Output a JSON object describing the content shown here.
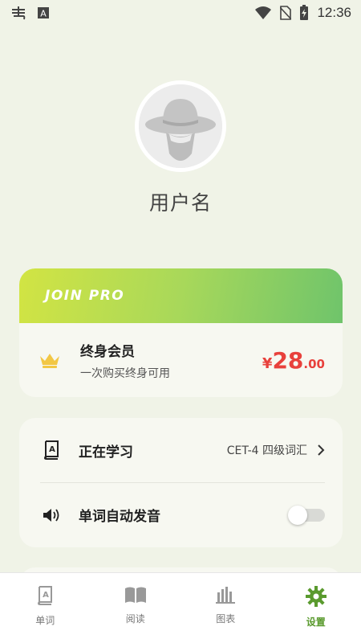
{
  "status_bar": {
    "time": "12:36"
  },
  "profile": {
    "username": "用户名"
  },
  "pro": {
    "title": "JOIN PRO",
    "plan_name": "终身会员",
    "plan_desc": "一次购买终身可用",
    "price_symbol": "¥",
    "price_int": "28",
    "price_dec": ".00"
  },
  "settings": {
    "studying_label": "正在学习",
    "studying_value": "CET-4 四级词汇",
    "autoplay_label": "单词自动发音",
    "autoplay_on": false
  },
  "bottom_nav": {
    "items": [
      {
        "label": "单词",
        "icon": "book-a-icon"
      },
      {
        "label": "阅读",
        "icon": "open-book-icon"
      },
      {
        "label": "图表",
        "icon": "bar-chart-icon"
      },
      {
        "label": "设置",
        "icon": "gear-icon",
        "active": true
      }
    ]
  },
  "colors": {
    "background": "#f0f3e7",
    "accent": "#5a9a2e",
    "price": "#e8413c",
    "crown": "#f2c744"
  }
}
